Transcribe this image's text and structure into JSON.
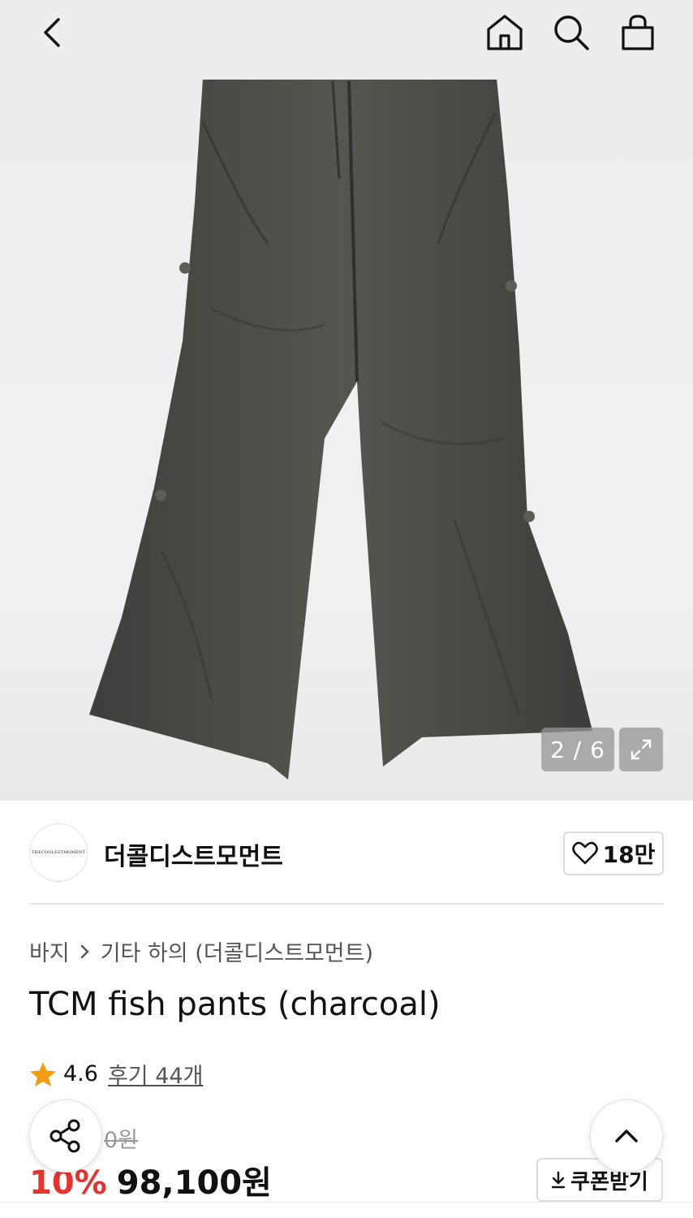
{
  "nav": {
    "back_icon": "chevron-left-icon",
    "home_icon": "home-icon",
    "search_icon": "search-icon",
    "cart_icon": "shopping-bag-icon"
  },
  "gallery": {
    "counter": "2 / 6",
    "current": 2,
    "total": 6,
    "expand_icon": "expand-icon",
    "image_alt_color": "#4a4b48"
  },
  "brand": {
    "logo_text": "THECOOLESTMOMENT",
    "name": "더콜디스트모먼트",
    "like_count": "18만"
  },
  "breadcrumb": [
    "바지",
    "기타 하의 (더콜디스트모먼트)"
  ],
  "product": {
    "title": "TCM fish pants (charcoal)",
    "rating": "4.6",
    "review_label": "후기 44개",
    "original_price": "0원",
    "discount": "10%",
    "price": "98,100원"
  },
  "buttons": {
    "coupon_label": "쿠폰받기"
  },
  "colors": {
    "accent_discount": "#e8322d",
    "star": "#f39c12",
    "text": "#111111"
  }
}
